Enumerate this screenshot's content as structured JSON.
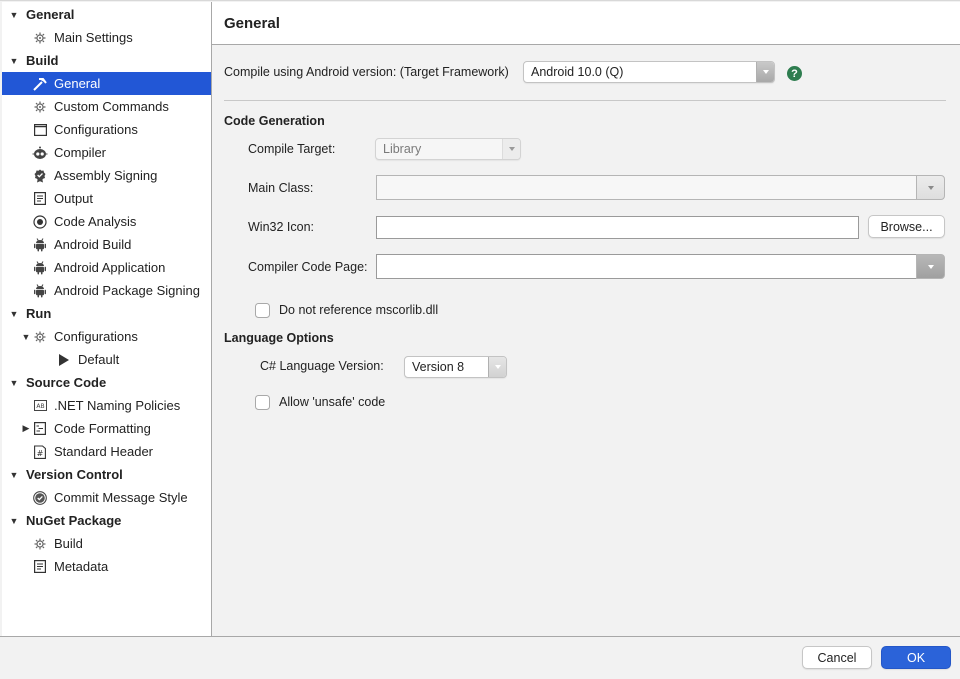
{
  "sidebar": {
    "items": [
      {
        "label": "General",
        "level": 0,
        "type": "header",
        "disclosure": "expanded",
        "icon": ""
      },
      {
        "label": "Main Settings",
        "level": 1,
        "type": "item",
        "disclosure": "",
        "icon": "gear-icon"
      },
      {
        "label": "Build",
        "level": 0,
        "type": "header",
        "disclosure": "expanded",
        "icon": ""
      },
      {
        "label": "General",
        "level": 1,
        "type": "item",
        "disclosure": "",
        "icon": "hammer-icon",
        "selected": true
      },
      {
        "label": "Custom Commands",
        "level": 1,
        "type": "item",
        "disclosure": "",
        "icon": "gear-icon"
      },
      {
        "label": "Configurations",
        "level": 1,
        "type": "item",
        "disclosure": "",
        "icon": "window-icon"
      },
      {
        "label": "Compiler",
        "level": 1,
        "type": "item",
        "disclosure": "",
        "icon": "robot-icon"
      },
      {
        "label": "Assembly Signing",
        "level": 1,
        "type": "item",
        "disclosure": "",
        "icon": "certificate-icon"
      },
      {
        "label": "Output",
        "level": 1,
        "type": "item",
        "disclosure": "",
        "icon": "document-icon"
      },
      {
        "label": "Code Analysis",
        "level": 1,
        "type": "item",
        "disclosure": "",
        "icon": "radio-icon"
      },
      {
        "label": "Android Build",
        "level": 1,
        "type": "item",
        "disclosure": "",
        "icon": "android-icon"
      },
      {
        "label": "Android Application",
        "level": 1,
        "type": "item",
        "disclosure": "",
        "icon": "android-icon"
      },
      {
        "label": "Android Package Signing",
        "level": 1,
        "type": "item",
        "disclosure": "",
        "icon": "android-icon"
      },
      {
        "label": "Run",
        "level": 0,
        "type": "header",
        "disclosure": "expanded",
        "icon": ""
      },
      {
        "label": "Configurations",
        "level": 1,
        "type": "item",
        "disclosure": "expanded",
        "icon": "gear-icon"
      },
      {
        "label": "Default",
        "level": 2,
        "type": "item",
        "disclosure": "",
        "icon": "play-icon"
      },
      {
        "label": "Source Code",
        "level": 0,
        "type": "header",
        "disclosure": "expanded",
        "icon": ""
      },
      {
        "label": ".NET Naming Policies",
        "level": 1,
        "type": "item",
        "disclosure": "",
        "icon": "naming-icon"
      },
      {
        "label": "Code Formatting",
        "level": 1,
        "type": "item",
        "disclosure": "collapsed",
        "icon": "format-icon"
      },
      {
        "label": "Standard Header",
        "level": 1,
        "type": "item",
        "disclosure": "",
        "icon": "hash-icon"
      },
      {
        "label": "Version Control",
        "level": 0,
        "type": "header",
        "disclosure": "expanded",
        "icon": ""
      },
      {
        "label": "Commit Message Style",
        "level": 1,
        "type": "item",
        "disclosure": "",
        "icon": "check-circle-icon"
      },
      {
        "label": "NuGet Package",
        "level": 0,
        "type": "header",
        "disclosure": "expanded",
        "icon": ""
      },
      {
        "label": "Build",
        "level": 1,
        "type": "item",
        "disclosure": "",
        "icon": "gear-icon"
      },
      {
        "label": "Metadata",
        "level": 1,
        "type": "item",
        "disclosure": "",
        "icon": "document-icon"
      }
    ]
  },
  "main": {
    "title": "General",
    "target_framework": {
      "label": "Compile using Android version: (Target Framework)",
      "value": "Android 10.0 (Q)",
      "help_icon": "?"
    },
    "code_generation": {
      "title": "Code Generation",
      "compile_target": {
        "label": "Compile Target:",
        "value": "Library"
      },
      "main_class": {
        "label": "Main Class:",
        "value": ""
      },
      "win32_icon": {
        "label": "Win32 Icon:",
        "value": "",
        "browse_label": "Browse..."
      },
      "compiler_code_page": {
        "label": "Compiler Code Page:",
        "value": ""
      },
      "no_mscorlib": {
        "label": "Do not reference mscorlib.dll",
        "checked": false
      }
    },
    "language_options": {
      "title": "Language Options",
      "csharp_version": {
        "label": "C# Language Version:",
        "value": "Version 8"
      },
      "allow_unsafe": {
        "label": "Allow 'unsafe' code",
        "checked": false
      }
    }
  },
  "footer": {
    "cancel_label": "Cancel",
    "ok_label": "OK"
  },
  "colors": {
    "accent": "#2257d6",
    "ok_button": "#2b63d9",
    "help_icon": "#2e7d4f"
  }
}
